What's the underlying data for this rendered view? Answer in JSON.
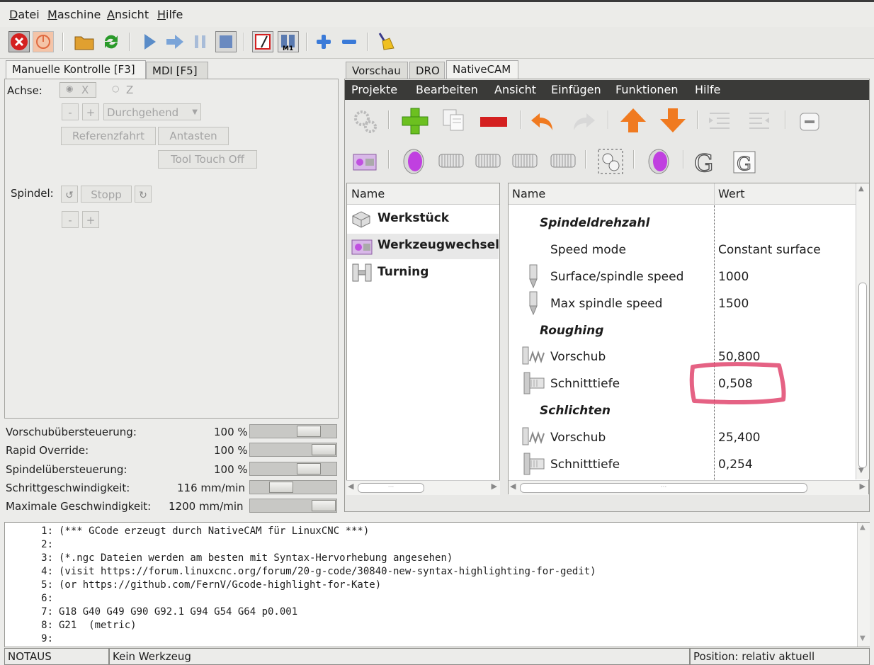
{
  "menubar": {
    "items": [
      "Datei",
      "Maschine",
      "Ansicht",
      "Hilfe"
    ]
  },
  "left_tabs": [
    "Manuelle Kontrolle [F3]",
    "MDI [F5]"
  ],
  "manual": {
    "axis_label": "Achse:",
    "axis_x": "X",
    "axis_z": "Z",
    "minus": "-",
    "plus": "+",
    "jog_mode": "Durchgehend",
    "home_button": "Referenzfahrt",
    "touch_button": "Antasten",
    "tool_touch_button": "Tool Touch Off",
    "spindle_label": "Spindel:",
    "spindle_stop": "Stopp"
  },
  "overrides": [
    {
      "label": "Vorschubübersteuerung:",
      "value": "100 %",
      "level": 0.75
    },
    {
      "label": "Rapid Override:",
      "value": "100 %",
      "level": 1.0
    },
    {
      "label": "Spindelübersteuerung:",
      "value": "100 %",
      "level": 0.75
    },
    {
      "label": "Schrittgeschwindigkeit:",
      "value": "116 mm/min",
      "level": 0.3
    },
    {
      "label": "Maximale Geschwindigkeit:",
      "value": "1200 mm/min",
      "level": 1.0
    }
  ],
  "right_tabs": [
    "Vorschau",
    "DRO",
    "NativeCAM"
  ],
  "ncam": {
    "menu": [
      "Projekte",
      "Bearbeiten",
      "Ansicht",
      "Einfügen",
      "Funktionen",
      "Hilfe"
    ],
    "tree_header": "Name",
    "tree_items": [
      "Werkstück",
      "Werkzeugwechsel",
      "Turning"
    ],
    "table_header_name": "Name",
    "table_header_value": "Wert",
    "rows": [
      {
        "type": "section",
        "name": "Spindeldrehzahl"
      },
      {
        "type": "row",
        "icon": "none",
        "name": "Speed mode",
        "value": "Constant surface"
      },
      {
        "type": "row",
        "icon": "spindle-icon",
        "name": "Surface/spindle speed",
        "value": "1000"
      },
      {
        "type": "row",
        "icon": "spindle-icon",
        "name": "Max spindle speed",
        "value": "1500"
      },
      {
        "type": "section",
        "name": "Roughing"
      },
      {
        "type": "row",
        "icon": "feed-icon",
        "name": "Vorschub",
        "value": "50,800"
      },
      {
        "type": "row",
        "icon": "depth-icon",
        "name": "Schnitttiefe",
        "value": "0,508"
      },
      {
        "type": "section",
        "name": "Schlichten"
      },
      {
        "type": "row",
        "icon": "feed-icon",
        "name": "Vorschub",
        "value": "25,400"
      },
      {
        "type": "row",
        "icon": "depth-icon",
        "name": "Schnitttiefe",
        "value": "0,254"
      }
    ],
    "scroll_dots": "···"
  },
  "gcode": [
    {
      "n": "1:",
      "t": "(*** GCode erzeugt durch NativeCAM für LinuxCNC ***)"
    },
    {
      "n": "2:",
      "t": ""
    },
    {
      "n": "3:",
      "t": "(*.ngc Dateien werden am besten mit Syntax-Hervorhebung angesehen)"
    },
    {
      "n": "4:",
      "t": "(visit https://forum.linuxcnc.org/forum/20-g-code/30840-new-syntax-highlighting-for-gedit)"
    },
    {
      "n": "5:",
      "t": "(or https://github.com/FernV/Gcode-highlight-for-Kate)"
    },
    {
      "n": "6:",
      "t": ""
    },
    {
      "n": "7:",
      "t": "G18 G40 G49 G90 G92.1 G94 G54 G64 p0.001"
    },
    {
      "n": "8:",
      "t": "G21  (metric)"
    },
    {
      "n": "9:",
      "t": ""
    }
  ],
  "status": {
    "estop": "NOTAUS",
    "tool": "Kein Werkzeug",
    "position": "Position: relativ aktuell"
  },
  "colors": {
    "highlight": "#e0466e",
    "accent_purple": "#c050e0",
    "estop_red": "#d42020"
  }
}
